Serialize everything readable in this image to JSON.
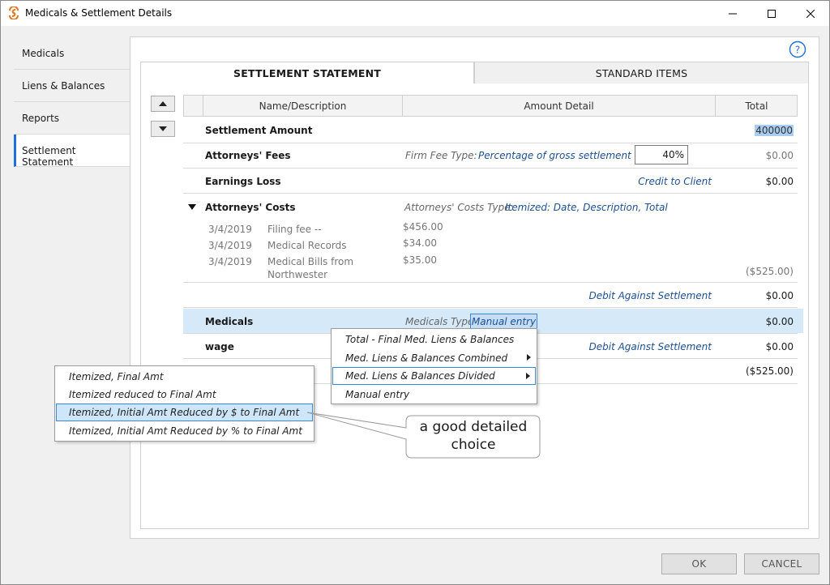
{
  "window": {
    "title": "Medicals & Settlement Details",
    "accent": "#1e6fd9"
  },
  "nav": {
    "items": [
      {
        "label": "Medicals",
        "active": false
      },
      {
        "label": "Liens & Balances",
        "active": false
      },
      {
        "label": "Reports",
        "active": false
      },
      {
        "label": "Settlement Statement",
        "active": true
      }
    ]
  },
  "tabs": [
    {
      "label": "SETTLEMENT STATEMENT",
      "active": true
    },
    {
      "label": "STANDARD ITEMS",
      "active": false
    }
  ],
  "grid": {
    "headers": {
      "name": "Name/Description",
      "amount": "Amount Detail",
      "total": "Total"
    },
    "settlement_amount": {
      "label": "Settlement Amount",
      "total": "400000"
    },
    "attorneys_fees": {
      "label": "Attorneys' Fees",
      "type_label": "Firm Fee Type:",
      "type_value": "Percentage of gross settlement",
      "percent": "40%",
      "total": "$0.00"
    },
    "earnings_loss": {
      "label": "Earnings Loss",
      "link": "Credit to Client",
      "total": "$0.00"
    },
    "attorneys_costs": {
      "label": "Attorneys' Costs",
      "type_label": "Attorneys' Costs Type:",
      "type_value": "Itemized: Date, Description, Total",
      "items": [
        {
          "date": "3/4/2019",
          "desc": "Filing fee --",
          "desc2": "",
          "amount": "$456.00"
        },
        {
          "date": "3/4/2019",
          "desc": "Medical Records",
          "desc2": "",
          "amount": "$34.00"
        },
        {
          "date": "3/4/2019",
          "desc": "Medical Bills from",
          "desc2": "Northwester",
          "amount": "$35.00"
        }
      ],
      "subtotal": "($525.00)",
      "link": "Debit Against Settlement",
      "total": "$0.00"
    },
    "medicals": {
      "label": "Medicals",
      "type_label": "Medicals Type:",
      "type_value": "Manual entry",
      "total": "$0.00"
    },
    "wage": {
      "label": "wage",
      "link": "Debit Against Settlement",
      "total": "$0.00"
    },
    "grand_total": "($525.00)"
  },
  "dropdown": {
    "items": [
      {
        "label": "Total - Final Med. Liens & Balances",
        "submenu": false
      },
      {
        "label": "Med. Liens & Balances Combined",
        "submenu": true
      },
      {
        "label": "Med. Liens & Balances Divided",
        "submenu": true,
        "hover": true
      },
      {
        "label": "Manual entry",
        "submenu": false
      }
    ]
  },
  "submenu": {
    "items": [
      {
        "label": "Itemized, Final Amt"
      },
      {
        "label": "Itemized reduced to Final Amt"
      },
      {
        "label": "Itemized, Initial Amt Reduced by $ to Final Amt",
        "hover": true
      },
      {
        "label": "Itemized, Initial Amt Reduced by % to Final Amt"
      }
    ]
  },
  "callout": {
    "line1": "a good detailed",
    "line2": "choice"
  },
  "buttons": {
    "ok": "OK",
    "cancel": "CANCEL"
  }
}
